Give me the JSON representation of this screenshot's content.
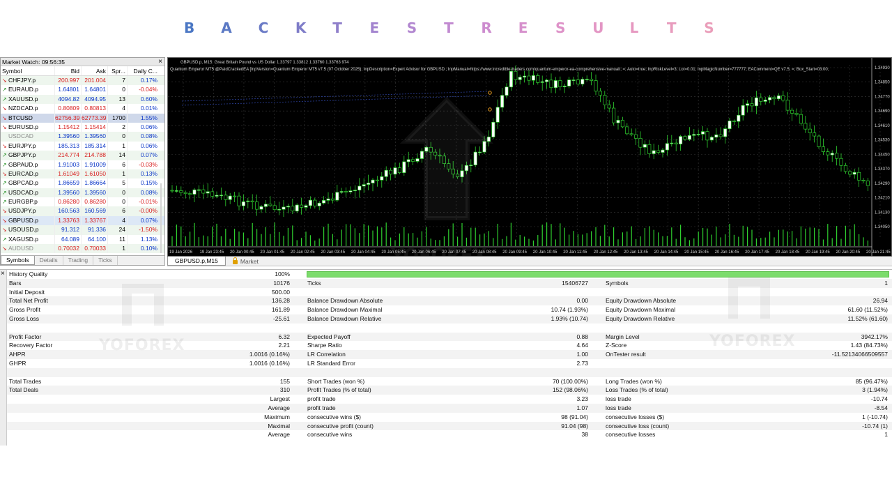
{
  "banner": {
    "letters": [
      "B",
      "A",
      "C",
      "K",
      "T",
      "E",
      "S",
      "T",
      "R",
      "E",
      "S",
      "U",
      "L",
      "T",
      "S"
    ],
    "colors": [
      "#4b77c4",
      "#5a78c4",
      "#6b7bc6",
      "#7e7cc8",
      "#8f7fca",
      "#a283ce",
      "#b287d0",
      "#c189d0",
      "#cd8ccf",
      "#d690cc",
      "#de92c8",
      "#e396c4",
      "#e698c0",
      "#e89bbd",
      "#ea9eba"
    ]
  },
  "market_watch": {
    "title": "Market Watch: 09:56:35",
    "close_label": "×",
    "columns": [
      "Symbol",
      "Bid",
      "Ask",
      "Spr...",
      "Daily C..."
    ],
    "rows": [
      {
        "symbol": "CHFJPY.p",
        "dir": "dn",
        "bid": "200.997",
        "ask": "201.004",
        "spread": "7",
        "change": "0.17%",
        "bid_color": "red",
        "ask_color": "red",
        "chg_color": "blu"
      },
      {
        "symbol": "EURAUD.p",
        "dir": "up",
        "bid": "1.64801",
        "ask": "1.64801",
        "spread": "0",
        "change": "-0.04%",
        "bid_color": "blu",
        "ask_color": "blu",
        "chg_color": "red"
      },
      {
        "symbol": "XAUUSD.p",
        "dir": "up",
        "bid": "4094.82",
        "ask": "4094.95",
        "spread": "13",
        "change": "0.60%",
        "bid_color": "blu",
        "ask_color": "blu",
        "chg_color": "blu"
      },
      {
        "symbol": "NZDCAD.p",
        "dir": "dn",
        "bid": "0.80809",
        "ask": "0.80813",
        "spread": "4",
        "change": "0.01%",
        "bid_color": "red",
        "ask_color": "red",
        "chg_color": "blu"
      },
      {
        "symbol": "BTCUSD",
        "dir": "dn",
        "bid": "62756.39",
        "ask": "62773.39",
        "spread": "1700",
        "change": "1.55%",
        "bid_color": "red",
        "ask_color": "red",
        "chg_color": "blu",
        "selected": true
      },
      {
        "symbol": "EURUSD.p",
        "dir": "dn",
        "bid": "1.15412",
        "ask": "1.15414",
        "spread": "2",
        "change": "0.06%",
        "bid_color": "red",
        "ask_color": "red",
        "chg_color": "blu"
      },
      {
        "symbol": "USDCAD",
        "dir": "none",
        "bid": "1.39560",
        "ask": "1.39560",
        "spread": "0",
        "change": "0.08%",
        "bid_color": "blu",
        "ask_color": "blu",
        "chg_color": "blu",
        "grey": true
      },
      {
        "symbol": "EURJPY.p",
        "dir": "dn",
        "bid": "185.313",
        "ask": "185.314",
        "spread": "1",
        "change": "0.06%",
        "bid_color": "blu",
        "ask_color": "blu",
        "chg_color": "blu"
      },
      {
        "symbol": "GBPJPY.p",
        "dir": "up",
        "bid": "214.774",
        "ask": "214.788",
        "spread": "14",
        "change": "0.07%",
        "bid_color": "red",
        "ask_color": "red",
        "chg_color": "blu"
      },
      {
        "symbol": "GBPAUD.p",
        "dir": "up",
        "bid": "1.91003",
        "ask": "1.91009",
        "spread": "6",
        "change": "-0.03%",
        "bid_color": "blu",
        "ask_color": "blu",
        "chg_color": "red"
      },
      {
        "symbol": "EURCAD.p",
        "dir": "dn",
        "bid": "1.61049",
        "ask": "1.61050",
        "spread": "1",
        "change": "0.13%",
        "bid_color": "red",
        "ask_color": "red",
        "chg_color": "blu"
      },
      {
        "symbol": "GBPCAD.p",
        "dir": "up",
        "bid": "1.86659",
        "ask": "1.86664",
        "spread": "5",
        "change": "0.15%",
        "bid_color": "blu",
        "ask_color": "blu",
        "chg_color": "blu"
      },
      {
        "symbol": "USDCAD.p",
        "dir": "up",
        "bid": "1.39560",
        "ask": "1.39560",
        "spread": "0",
        "change": "0.08%",
        "bid_color": "blu",
        "ask_color": "blu",
        "chg_color": "blu"
      },
      {
        "symbol": "EURGBP.p",
        "dir": "up",
        "bid": "0.86280",
        "ask": "0.86280",
        "spread": "0",
        "change": "-0.01%",
        "bid_color": "red",
        "ask_color": "red",
        "chg_color": "red"
      },
      {
        "symbol": "USDJPY.p",
        "dir": "dn",
        "bid": "160.563",
        "ask": "160.569",
        "spread": "6",
        "change": "-0.00%",
        "bid_color": "blu",
        "ask_color": "blu",
        "chg_color": "red"
      },
      {
        "symbol": "GBPUSD.p",
        "dir": "dn",
        "bid": "1.33763",
        "ask": "1.33767",
        "spread": "4",
        "change": "0.07%",
        "bid_color": "red",
        "ask_color": "red",
        "chg_color": "blu",
        "highlight": true
      },
      {
        "symbol": "USOUSD.p",
        "dir": "dn",
        "bid": "91.312",
        "ask": "91.336",
        "spread": "24",
        "change": "-1.50%",
        "bid_color": "blu",
        "ask_color": "blu",
        "chg_color": "red"
      },
      {
        "symbol": "XAGUSD.p",
        "dir": "up",
        "bid": "64.089",
        "ask": "64.100",
        "spread": "11",
        "change": "1.13%",
        "bid_color": "blu",
        "ask_color": "blu",
        "chg_color": "blu"
      },
      {
        "symbol": "AUDUSD",
        "dir": "dn",
        "bid": "0.70032",
        "ask": "0.70033",
        "spread": "1",
        "change": "0.10%",
        "bid_color": "red",
        "ask_color": "red",
        "chg_color": "blu",
        "grey": true
      }
    ],
    "tabs": [
      "Symbols",
      "Details",
      "Trading",
      "Ticks"
    ],
    "active_tab": 0
  },
  "chart": {
    "info_line1": "GBPUSD.p, M15:  Great Britain Pound vs US Dollar  1.33797 1.33812 1.33760 1.33763  974",
    "info_line2": "Quantum Emperor MT5 @PaidCrackedEA [InpVersion=Quantum Emperor MT5 v7.5 (07 October 2025); InpDescription=Expert Advisor for GBPUSD.; InpManual=https://www.incredible-traders.com/quantum-emperor-ea-comprehensive-manual/; =; Auto=true; InpRiskLevel=3; Lot=0.01; InpMagicNumber=777777; EAComment=QE v7.5; =; Box_Start=03:00;",
    "price_labels": [
      "1.34930",
      "1.34850",
      "1.34770",
      "1.34690",
      "1.34610",
      "1.34530",
      "1.34450",
      "1.34370",
      "1.34290",
      "1.34210",
      "1.34130",
      "1.34050"
    ],
    "time_labels": [
      "19 Jan 2026",
      "19 Jan 23:45",
      "20 Jan 00:45",
      "20 Jan 01:45",
      "20 Jan 02:45",
      "20 Jan 03:45",
      "20 Jan 04:45",
      "20 Jan 05:45",
      "20 Jan 06:45",
      "20 Jan 07:45",
      "20 Jan 08:45",
      "20 Jan 09:45",
      "20 Jan 10:45",
      "20 Jan 11:45",
      "20 Jan 12:45",
      "20 Jan 13:45",
      "20 Jan 14:45",
      "20 Jan 15:45",
      "20 Jan 16:45",
      "20 Jan 17:45",
      "20 Jan 18:45",
      "20 Jan 19:45",
      "20 Jan 20:45",
      "20 Jan 21:45"
    ],
    "tabs": [
      "GBPUSD.p,M15",
      "Market"
    ],
    "active_tab": 0,
    "watermark": "YOFOREX"
  },
  "report": {
    "close_label": "×",
    "history_quality_label": "History Quality",
    "history_quality_value": "100%",
    "history_quality_fill": 1.0,
    "rows": [
      {
        "l1": "Bars",
        "v1": "10176",
        "l2": "Ticks",
        "v2": "15406727",
        "l3": "Symbols",
        "v3": "1"
      },
      {
        "l1": "Initial Deposit",
        "v1": "500.00",
        "l2": "",
        "v2": "",
        "l3": "",
        "v3": ""
      },
      {
        "l1": "Total Net Profit",
        "v1": "136.28",
        "l2": "Balance Drawdown Absolute",
        "v2": "0.00",
        "l3": "Equity Drawdown Absolute",
        "v3": "26.94"
      },
      {
        "l1": "Gross Profit",
        "v1": "161.89",
        "l2": "Balance Drawdown Maximal",
        "v2": "10.74 (1.93%)",
        "l3": "Equity Drawdown Maximal",
        "v3": "61.60 (11.52%)"
      },
      {
        "l1": "Gross Loss",
        "v1": "-25.61",
        "l2": "Balance Drawdown Relative",
        "v2": "1.93% (10.74)",
        "l3": "Equity Drawdown Relative",
        "v3": "11.52% (61.60)"
      },
      {
        "l1": "",
        "v1": "",
        "l2": "",
        "v2": "",
        "l3": "",
        "v3": ""
      },
      {
        "l1": "Profit Factor",
        "v1": "6.32",
        "l2": "Expected Payoff",
        "v2": "0.88",
        "l3": "Margin Level",
        "v3": "3942.17%"
      },
      {
        "l1": "Recovery Factor",
        "v1": "2.21",
        "l2": "Sharpe Ratio",
        "v2": "4.64",
        "l3": "Z-Score",
        "v3": "1.43 (84.73%)"
      },
      {
        "l1": "AHPR",
        "v1": "1.0016 (0.16%)",
        "l2": "LR Correlation",
        "v2": "1.00",
        "l3": "OnTester result",
        "v3": "-11.52134066509557"
      },
      {
        "l1": "GHPR",
        "v1": "1.0016 (0.16%)",
        "l2": "LR Standard Error",
        "v2": "2.73",
        "l3": "",
        "v3": ""
      },
      {
        "l1": "",
        "v1": "",
        "l2": "",
        "v2": "",
        "l3": "",
        "v3": ""
      },
      {
        "l1": "Total Trades",
        "v1": "155",
        "l2": "Short Trades (won %)",
        "v2": "70 (100.00%)",
        "l3": "Long Trades (won %)",
        "v3": "85 (96.47%)"
      },
      {
        "l1": "Total Deals",
        "v1": "310",
        "l2": "Profit Trades (% of total)",
        "v2": "152 (98.06%)",
        "l3": "Loss Trades (% of total)",
        "v3": "3 (1.94%)"
      },
      {
        "l1": "",
        "v1": "Largest",
        "l2": "profit trade",
        "v2": "3.23",
        "l3": "loss trade",
        "v3": "-10.74"
      },
      {
        "l1": "",
        "v1": "Average",
        "l2": "profit trade",
        "v2": "1.07",
        "l3": "loss trade",
        "v3": "-8.54"
      },
      {
        "l1": "",
        "v1": "Maximum",
        "l2": "consecutive wins ($)",
        "v2": "98 (91.04)",
        "l3": "consecutive losses ($)",
        "v3": "1 (-10.74)"
      },
      {
        "l1": "",
        "v1": "Maximal",
        "l2": "consecutive profit (count)",
        "v2": "91.04 (98)",
        "l3": "consecutive loss (count)",
        "v3": "-10.74 (1)"
      },
      {
        "l1": "",
        "v1": "Average",
        "l2": "consecutive wins",
        "v2": "38",
        "l3": "consecutive losses",
        "v3": "1"
      }
    ]
  }
}
